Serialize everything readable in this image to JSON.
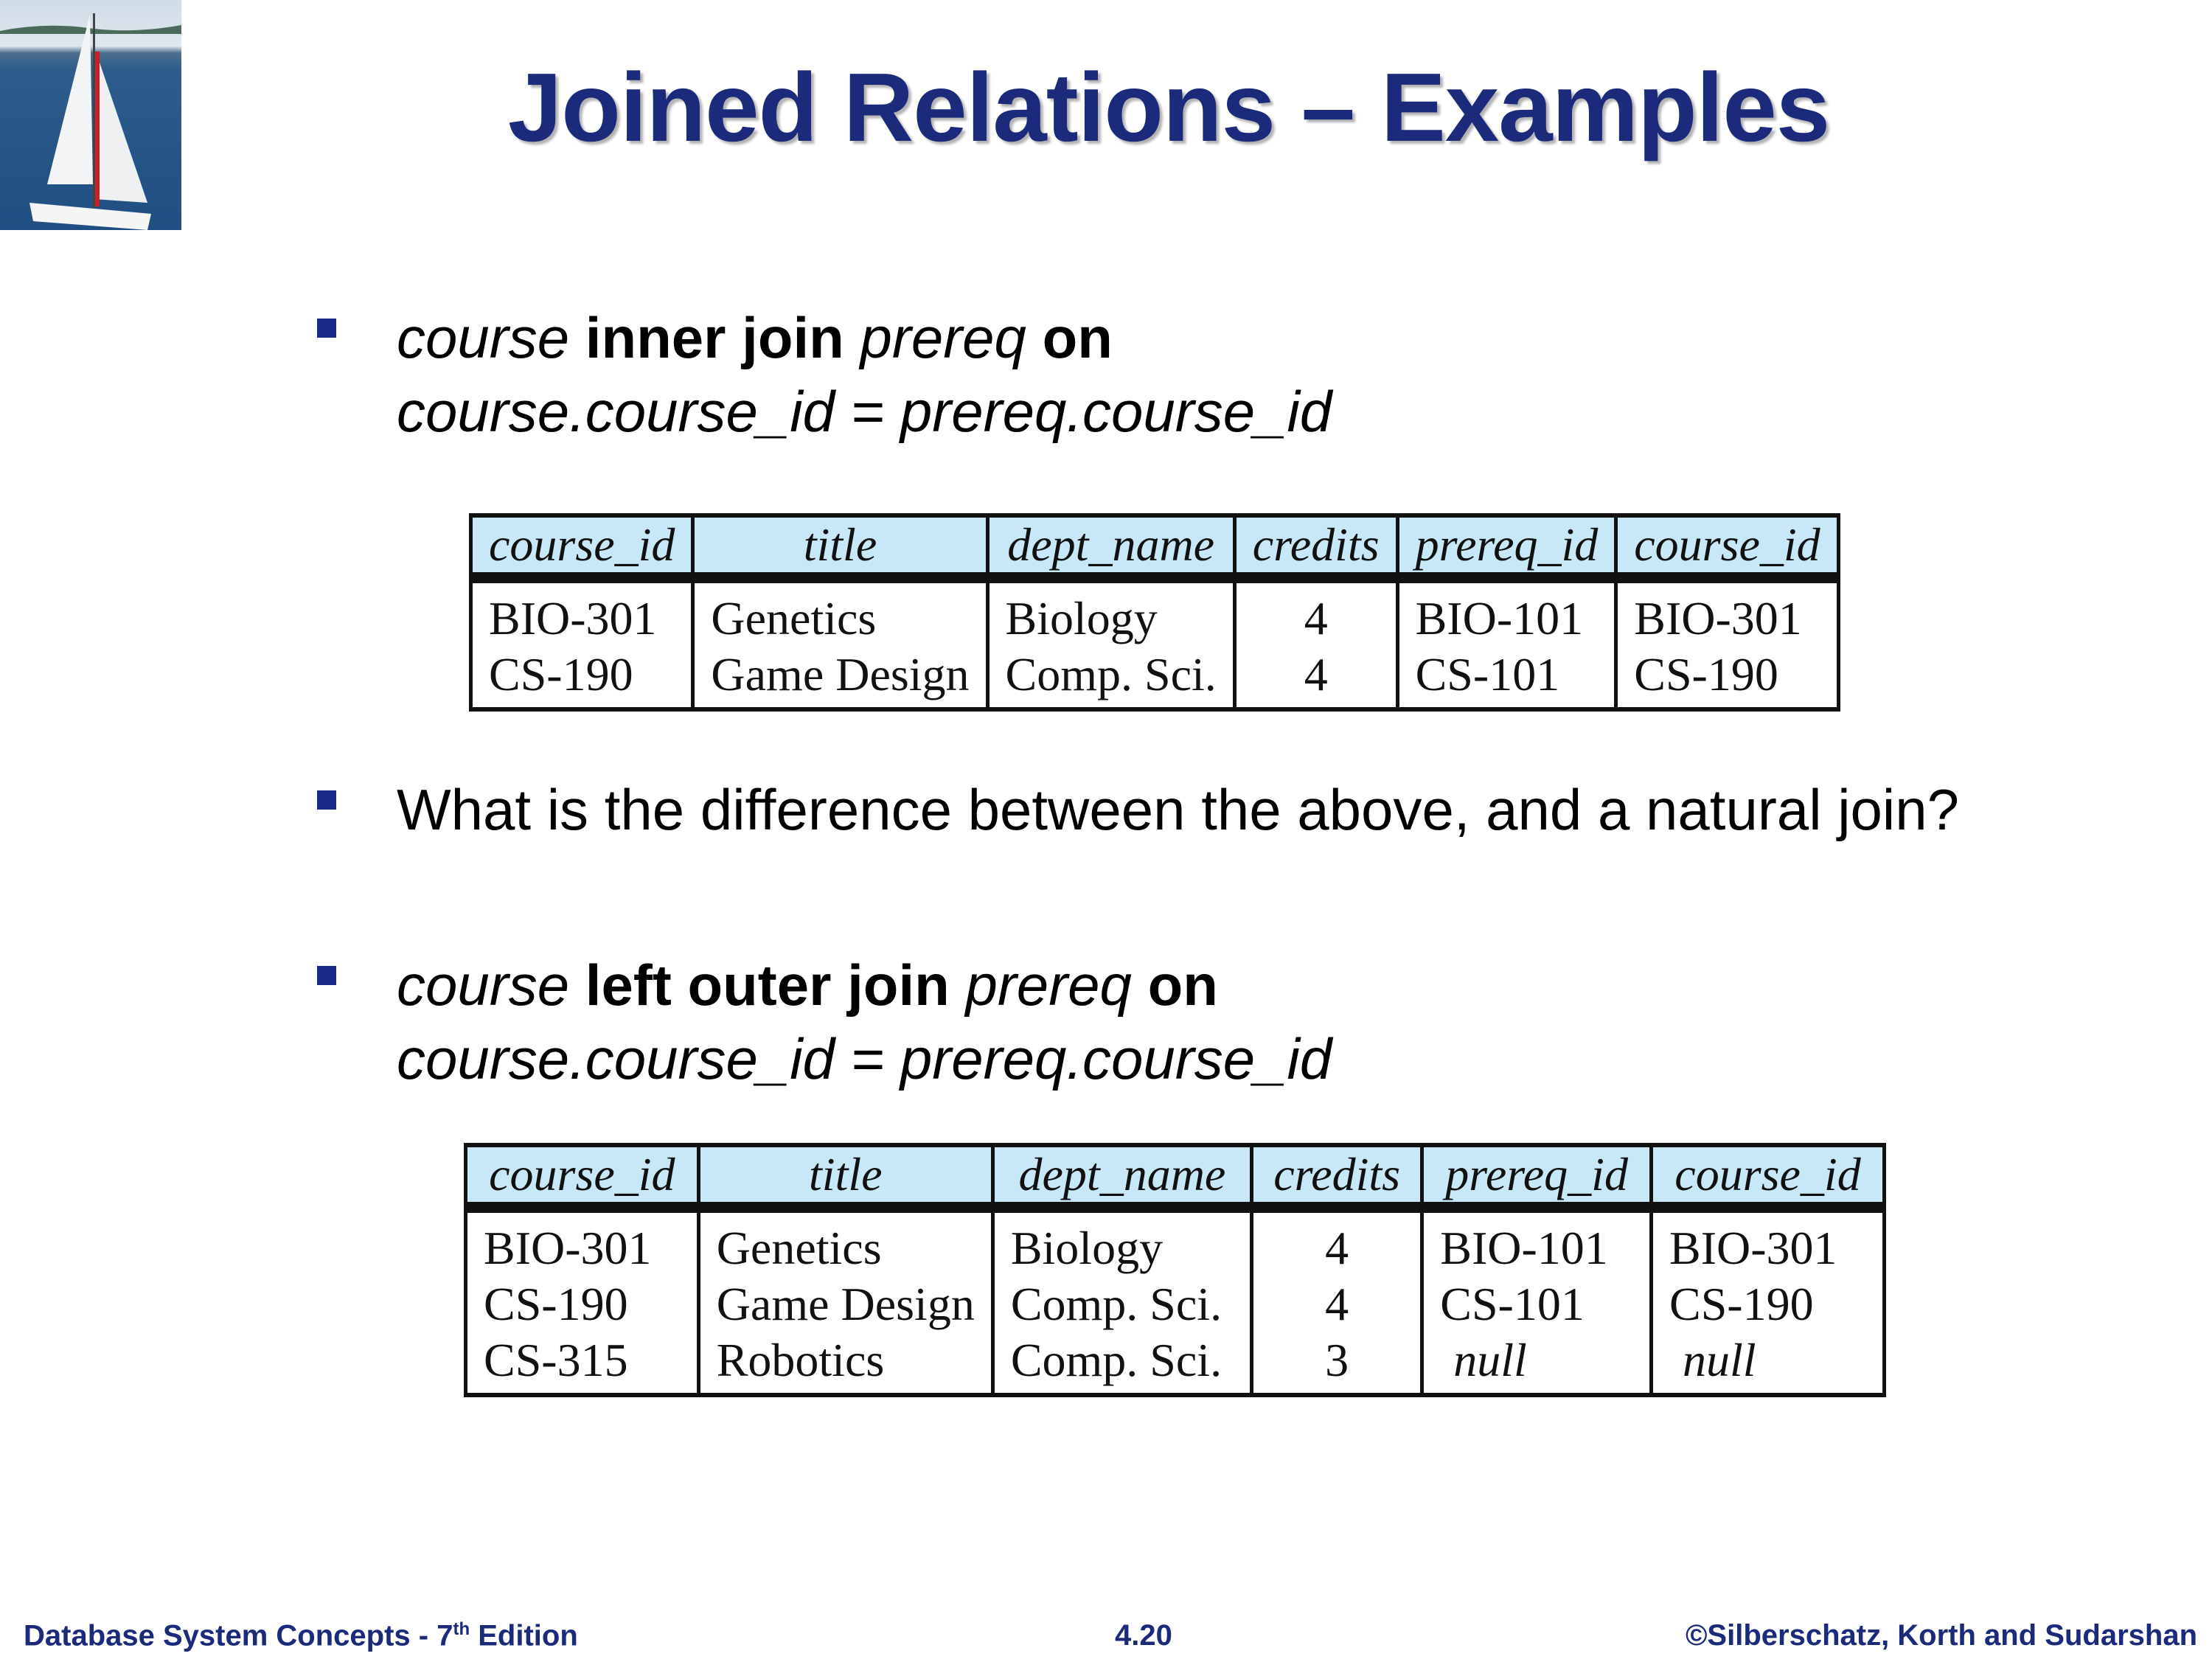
{
  "slide": {
    "title": "Joined Relations – Examples",
    "bullets": [
      {
        "rel1": "course",
        "op": "inner join",
        "rel2": "prereq",
        "on": "on",
        "condition": "course.course_id = prereq.course_id"
      },
      {
        "text": "What is the difference between the above, and a natural join?"
      },
      {
        "rel1": "course",
        "op": "left outer join",
        "rel2": "prereq",
        "on": "on",
        "condition": "course.course_id = prereq.course_id"
      }
    ],
    "table1": {
      "columns": [
        "course_id",
        "title",
        "dept_name",
        "credits",
        "prereq_id",
        "course_id"
      ],
      "rows": [
        [
          "BIO-301",
          "Genetics",
          "Biology",
          "4",
          "BIO-101",
          "BIO-301"
        ],
        [
          "CS-190",
          "Game Design",
          "Comp. Sci.",
          "4",
          "CS-101",
          "CS-190"
        ]
      ]
    },
    "table2": {
      "columns": [
        "course_id",
        "title",
        "dept_name",
        "credits",
        "prereq_id",
        "course_id"
      ],
      "rows": [
        [
          "BIO-301",
          "Genetics",
          "Biology",
          "4",
          "BIO-101",
          "BIO-301"
        ],
        [
          "CS-190",
          "Game Design",
          "Comp. Sci.",
          "4",
          "CS-101",
          "CS-190"
        ],
        [
          "CS-315",
          "Robotics",
          "Comp. Sci.",
          "3",
          "null",
          "null"
        ]
      ]
    }
  },
  "footer": {
    "book": "Database System Concepts - 7",
    "sup": "th",
    "edition": " Edition",
    "page": "4.20",
    "copyright": "©Silberschatz, Korth and Sudarshan"
  },
  "colors": {
    "title": "#1b2a7a",
    "header_fill": "#c8e8f8",
    "bullet": "#1b2a8a"
  }
}
